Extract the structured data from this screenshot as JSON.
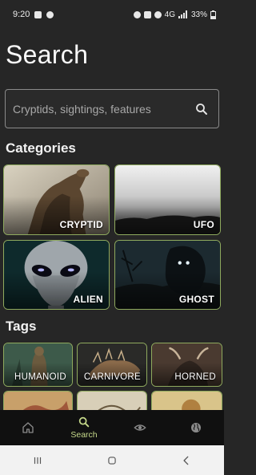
{
  "status_bar": {
    "time": "9:20",
    "network": "4G",
    "battery": "33%"
  },
  "page": {
    "title": "Search"
  },
  "search": {
    "placeholder": "Cryptids, sightings, features"
  },
  "sections": {
    "categories_title": "Categories",
    "tags_title": "Tags"
  },
  "categories": [
    {
      "label": "CRYPTID"
    },
    {
      "label": "UFO"
    },
    {
      "label": "ALIEN"
    },
    {
      "label": "GHOST"
    }
  ],
  "tags": [
    {
      "label": "HUMANOID"
    },
    {
      "label": "CARNIVORE"
    },
    {
      "label": "HORNED"
    }
  ],
  "bottom_nav": {
    "items": [
      {
        "icon": "home-icon",
        "label": ""
      },
      {
        "icon": "search-icon",
        "label": "Search",
        "active": true
      },
      {
        "icon": "eye-icon",
        "label": ""
      },
      {
        "icon": "globe-icon",
        "label": ""
      }
    ]
  },
  "colors": {
    "background": "#262626",
    "accent": "#c5d88a",
    "card_border": "#8faa5e",
    "nav_background": "#101010"
  }
}
